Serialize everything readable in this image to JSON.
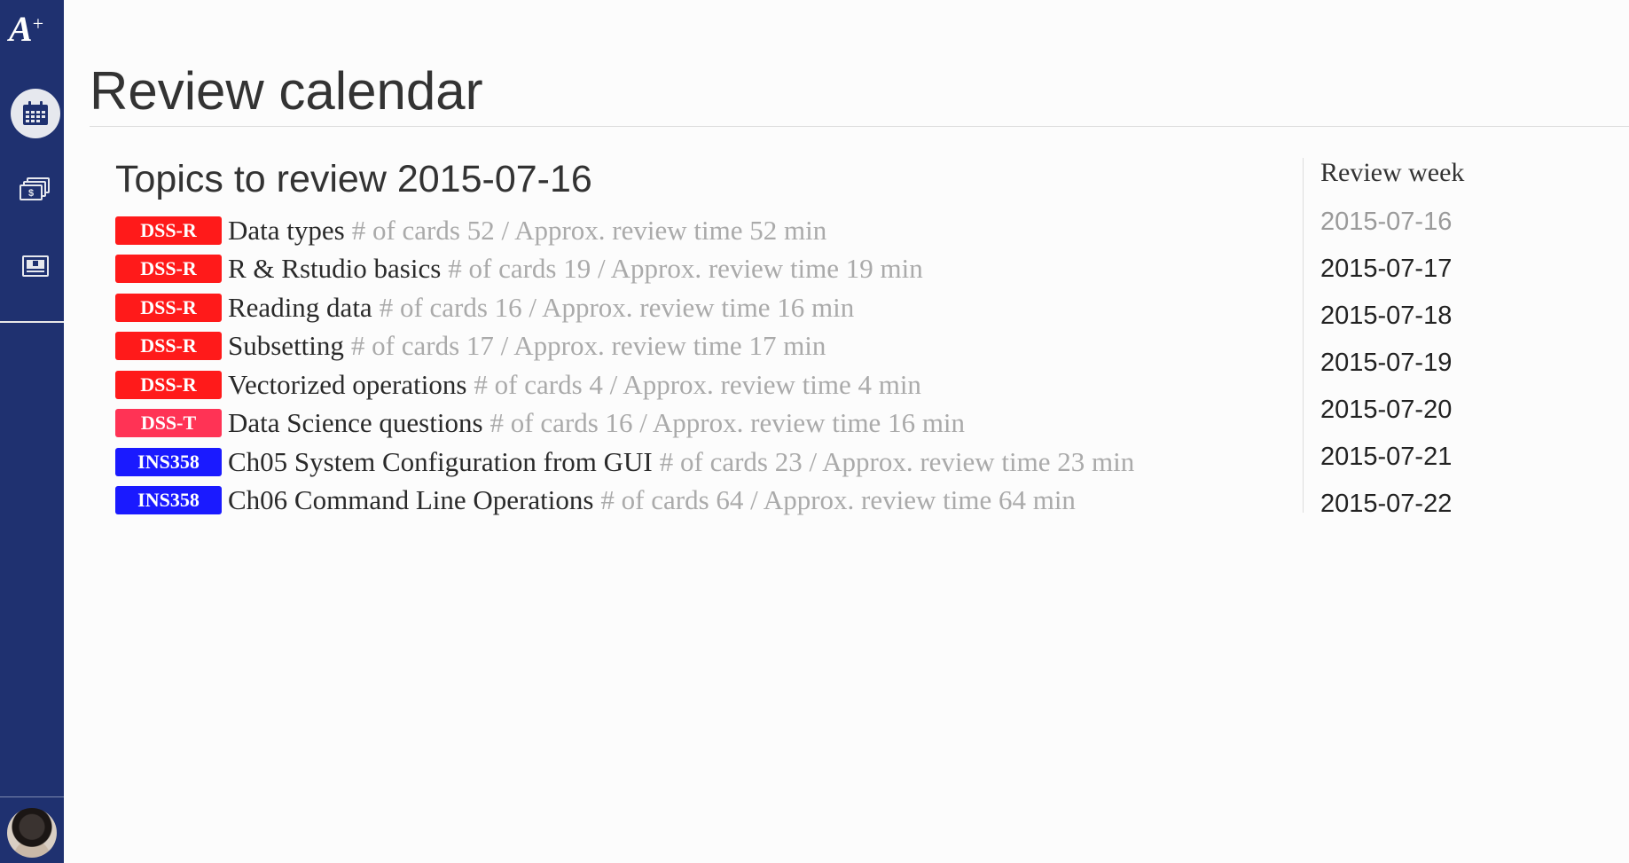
{
  "sidebar": {
    "logo": "A",
    "logo_plus": "+",
    "items": [
      {
        "name": "calendar",
        "icon": "calendar-icon",
        "active": true
      },
      {
        "name": "cards",
        "icon": "card-stack-icon",
        "active": false
      },
      {
        "name": "slides",
        "icon": "slide-icon",
        "active": false
      }
    ],
    "avatar": "user-avatar"
  },
  "header": {
    "title": "Review calendar"
  },
  "topics": {
    "heading": "Topics to review 2015-07-16",
    "items": [
      {
        "badge": "DSS-R",
        "badge_color": "#ff1a1a",
        "name": "Data types",
        "meta": "# of cards 52 / Approx. review time 52 min"
      },
      {
        "badge": "DSS-R",
        "badge_color": "#ff1a1a",
        "name": "R & Rstudio basics",
        "meta": "# of cards 19 / Approx. review time 19 min"
      },
      {
        "badge": "DSS-R",
        "badge_color": "#ff1a1a",
        "name": "Reading data",
        "meta": "# of cards 16 / Approx. review time 16 min"
      },
      {
        "badge": "DSS-R",
        "badge_color": "#ff1a1a",
        "name": "Subsetting",
        "meta": "# of cards 17 / Approx. review time 17 min"
      },
      {
        "badge": "DSS-R",
        "badge_color": "#ff1a1a",
        "name": "Vectorized operations",
        "meta": "# of cards 4 / Approx. review time 4 min"
      },
      {
        "badge": "DSS-T",
        "badge_color": "#ff3355",
        "name": "Data Science questions",
        "meta": "# of cards 16 / Approx. review time 16 min"
      },
      {
        "badge": "INS358",
        "badge_color": "#1a1aff",
        "name": "Ch05 System Configuration from GUI",
        "meta": "# of cards 23 / Approx. review time 23 min"
      },
      {
        "badge": "INS358",
        "badge_color": "#1a1aff",
        "name": "Ch06 Command Line Operations",
        "meta": "# of cards 64 / Approx. review time 64 min"
      }
    ]
  },
  "review_week": {
    "heading": "Review week",
    "dates": [
      "2015-07-16",
      "2015-07-17",
      "2015-07-18",
      "2015-07-19",
      "2015-07-20",
      "2015-07-21",
      "2015-07-22"
    ],
    "current": "2015-07-16"
  }
}
